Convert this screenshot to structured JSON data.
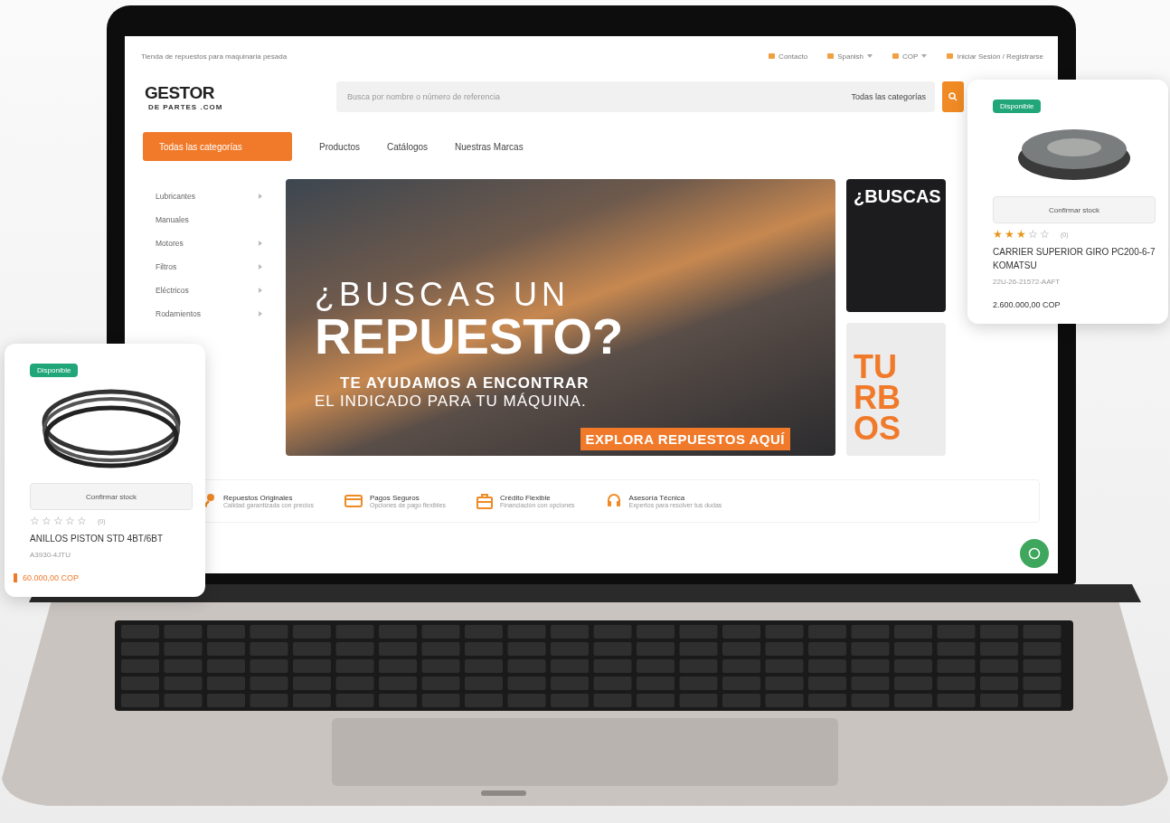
{
  "topbar": {
    "tagline": "Tienda de repuestos para maquinaria pesada",
    "links": [
      {
        "label": "Contacto",
        "dropdown": false
      },
      {
        "label": "Spanish",
        "dropdown": true
      },
      {
        "label": "COP",
        "dropdown": true
      },
      {
        "label": "Iniciar Sesión / Registrarse",
        "dropdown": false
      }
    ]
  },
  "header": {
    "logo_main": "GESTOR",
    "logo_sub": "DE PARTES .COM",
    "search": {
      "placeholder": "Busca por nombre o número de referencia"
    },
    "category_select": "Todas las categorías"
  },
  "nav": {
    "categories_button": "Todas las categorías",
    "links": [
      "Productos",
      "Catálogos",
      "Nuestras Marcas"
    ]
  },
  "sidebar": {
    "items": [
      {
        "label": "Lubricantes",
        "has_children": true
      },
      {
        "label": "Manuales",
        "has_children": false
      },
      {
        "label": "Motores",
        "has_children": true
      },
      {
        "label": "Filtros",
        "has_children": true
      },
      {
        "label": "Eléctricos",
        "has_children": true
      },
      {
        "label": "Rodamientos",
        "has_children": true
      }
    ]
  },
  "hero": {
    "line1": "¿BUSCAS UN",
    "line2": "REPUESTO?",
    "line3": "TE AYUDAMOS A ENCONTRAR",
    "line4": "EL INDICADO PARA TU MÁQUINA.",
    "cta": "EXPLORA REPUESTOS AQUÍ"
  },
  "side_banners": [
    {
      "kind": "dark",
      "title": "¿BUSCAS"
    },
    {
      "kind": "light",
      "title": "TURBOS"
    }
  ],
  "features": [
    {
      "kind": "key",
      "title": "Repuestos Originales",
      "text": "Calidad garantizada con precios"
    },
    {
      "kind": "card",
      "title": "Pagos Seguros",
      "text": "Opciones de pago flexibles"
    },
    {
      "kind": "bag",
      "title": "Crédito Flexible",
      "text": "Financiación con opciones"
    },
    {
      "kind": "headset",
      "title": "Asesoría Técnica",
      "text": "Expertos para resolver tus dudas"
    }
  ],
  "cards": [
    {
      "badge": "Disponible",
      "kind": "rings",
      "button": "Confirmar stock",
      "stars": 0,
      "reviews": "(0)",
      "name": "ANILLOS PISTON STD 4BT/6BT",
      "ref": "A3930-4JTU",
      "price": "60.000,00 COP",
      "price_marker": true
    },
    {
      "badge": "Disponible",
      "kind": "carrier",
      "button": "Confirmar stock",
      "stars": 3,
      "reviews": "(0)",
      "name": "CARRIER SUPERIOR GIRO PC200-6-7 KOMATSU",
      "ref": "22U-26-21572-AAFT",
      "price": "2.600.000,00 COP",
      "price_marker": false
    }
  ]
}
